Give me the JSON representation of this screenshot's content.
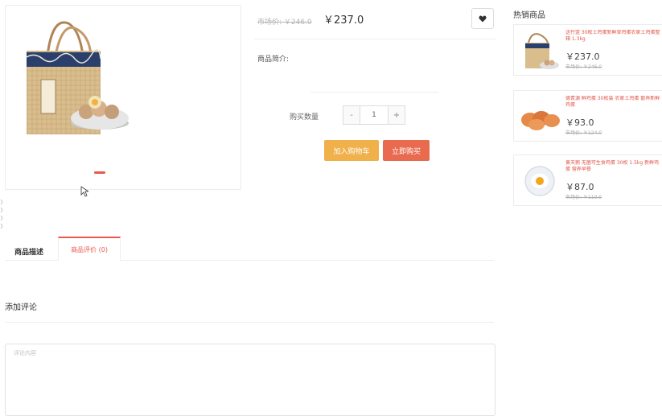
{
  "product": {
    "market_price": "市场价: ￥246.0",
    "price": "￥237.0",
    "intro_label": "商品简介:",
    "quantity_label": "购买数量",
    "quantity_value": "1",
    "minus": "-",
    "plus": "+",
    "add_to_cart": "加入购物车",
    "buy_now": "立即购买",
    "favorite_icon": "heart-icon"
  },
  "hot": {
    "title": "热销商品",
    "items": [
      {
        "name": "送竹篮 30枚土鸡蛋新鲜草鸡蛋农家土鸡蛋整箱 1.3kg",
        "price": "￥237.0",
        "old_price": "市场价: ￥246.0"
      },
      {
        "name": "德青源 鲜鸡蛋 30枚装 农家土鸡蛋 散养新鲜鸡蛋",
        "price": "￥93.0",
        "old_price": "市场价: ￥124.0"
      },
      {
        "name": "黄天鹅 无菌可生食鸡蛋 30枚 1.5kg 新鲜鸡蛋 营养早餐",
        "price": "￥87.0",
        "old_price": "市场价: ￥110.0"
      }
    ]
  },
  "tabs": {
    "description": "商品描述",
    "reviews": "商品评价 (0)"
  },
  "review": {
    "heading": "添加评论",
    "placeholder": "评论内容"
  },
  "colors": {
    "accent": "#e85a4f",
    "cart": "#f0b04a",
    "buy": "#e86a4f"
  }
}
